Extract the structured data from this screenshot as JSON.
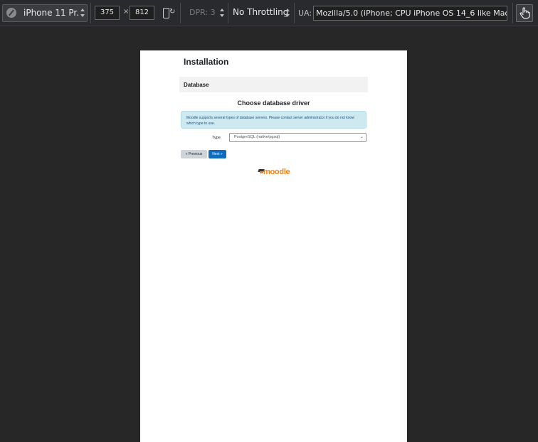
{
  "devtools": {
    "device": "iPhone 11 Pr...",
    "width": "375",
    "height": "812",
    "times": "×",
    "dpr": "DPR: 3",
    "throttling": "No Throttling",
    "ua_label": "UA:",
    "ua_value": "Mozilla/5.0 (iPhone; CPU iPhone OS 14_6 like Mac"
  },
  "page": {
    "title": "Installation",
    "section": "Database",
    "heading": "Choose database driver",
    "notice": "Moodle supports several types of database servers. Please contact server administrator if you do not know which type to use.",
    "type_label": "Type",
    "type_value": "PostgreSQL (native/pgsql)",
    "prev_button": "« Previous",
    "next_button": "Next »",
    "logo_text": "moodle"
  }
}
